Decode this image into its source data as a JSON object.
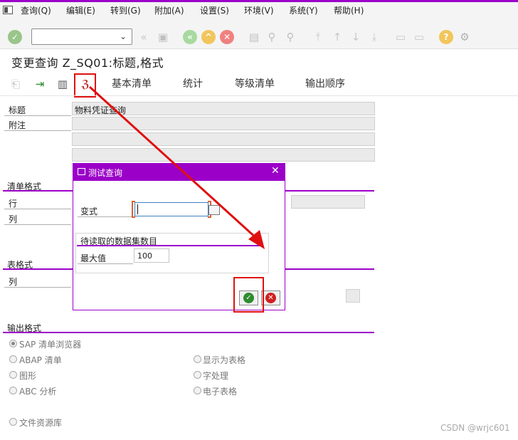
{
  "menu": {
    "items": [
      "查询(Q)",
      "编辑(E)",
      "转到(G)",
      "附加(A)",
      "设置(S)",
      "环境(V)",
      "系统(Y)",
      "帮助(H)"
    ]
  },
  "toolbar": {
    "command_value": ""
  },
  "page": {
    "title": "变更查询 Z_SQ01:标题,格式"
  },
  "app_toolbar": {
    "tabs": [
      "基本清单",
      "统计",
      "等级清单",
      "输出顺序"
    ]
  },
  "header_section": {
    "title_label": "标题",
    "title_value": "物料凭证查询",
    "note_label": "附注"
  },
  "list_format": {
    "title": "清单格式",
    "row_label": "行",
    "col_label": "列"
  },
  "table_format": {
    "title": "表格式",
    "col_label": "列"
  },
  "output_format": {
    "title": "输出格式",
    "options": {
      "sap_list_viewer": "SAP 清单浏览器",
      "abap_list": "ABAP 清单",
      "graphic": "图形",
      "abc_analysis": "ABC 分析",
      "file_store": "文件资源库",
      "display_table": "显示为表格",
      "word_processing": "字处理",
      "spreadsheet": "电子表格"
    },
    "selected": "sap_list_viewer"
  },
  "dialog": {
    "title": "测试查询",
    "variant_label": "变式",
    "variant_value": "",
    "group_title": "待读取的数据集数目",
    "max_label": "最大值",
    "max_value": "100"
  },
  "watermark": "CSDN @wrjc601",
  "colors": {
    "accent": "#9b00c8",
    "highlight": "#e01010",
    "ok": "#2e8b2e",
    "cancel": "#d02020"
  }
}
